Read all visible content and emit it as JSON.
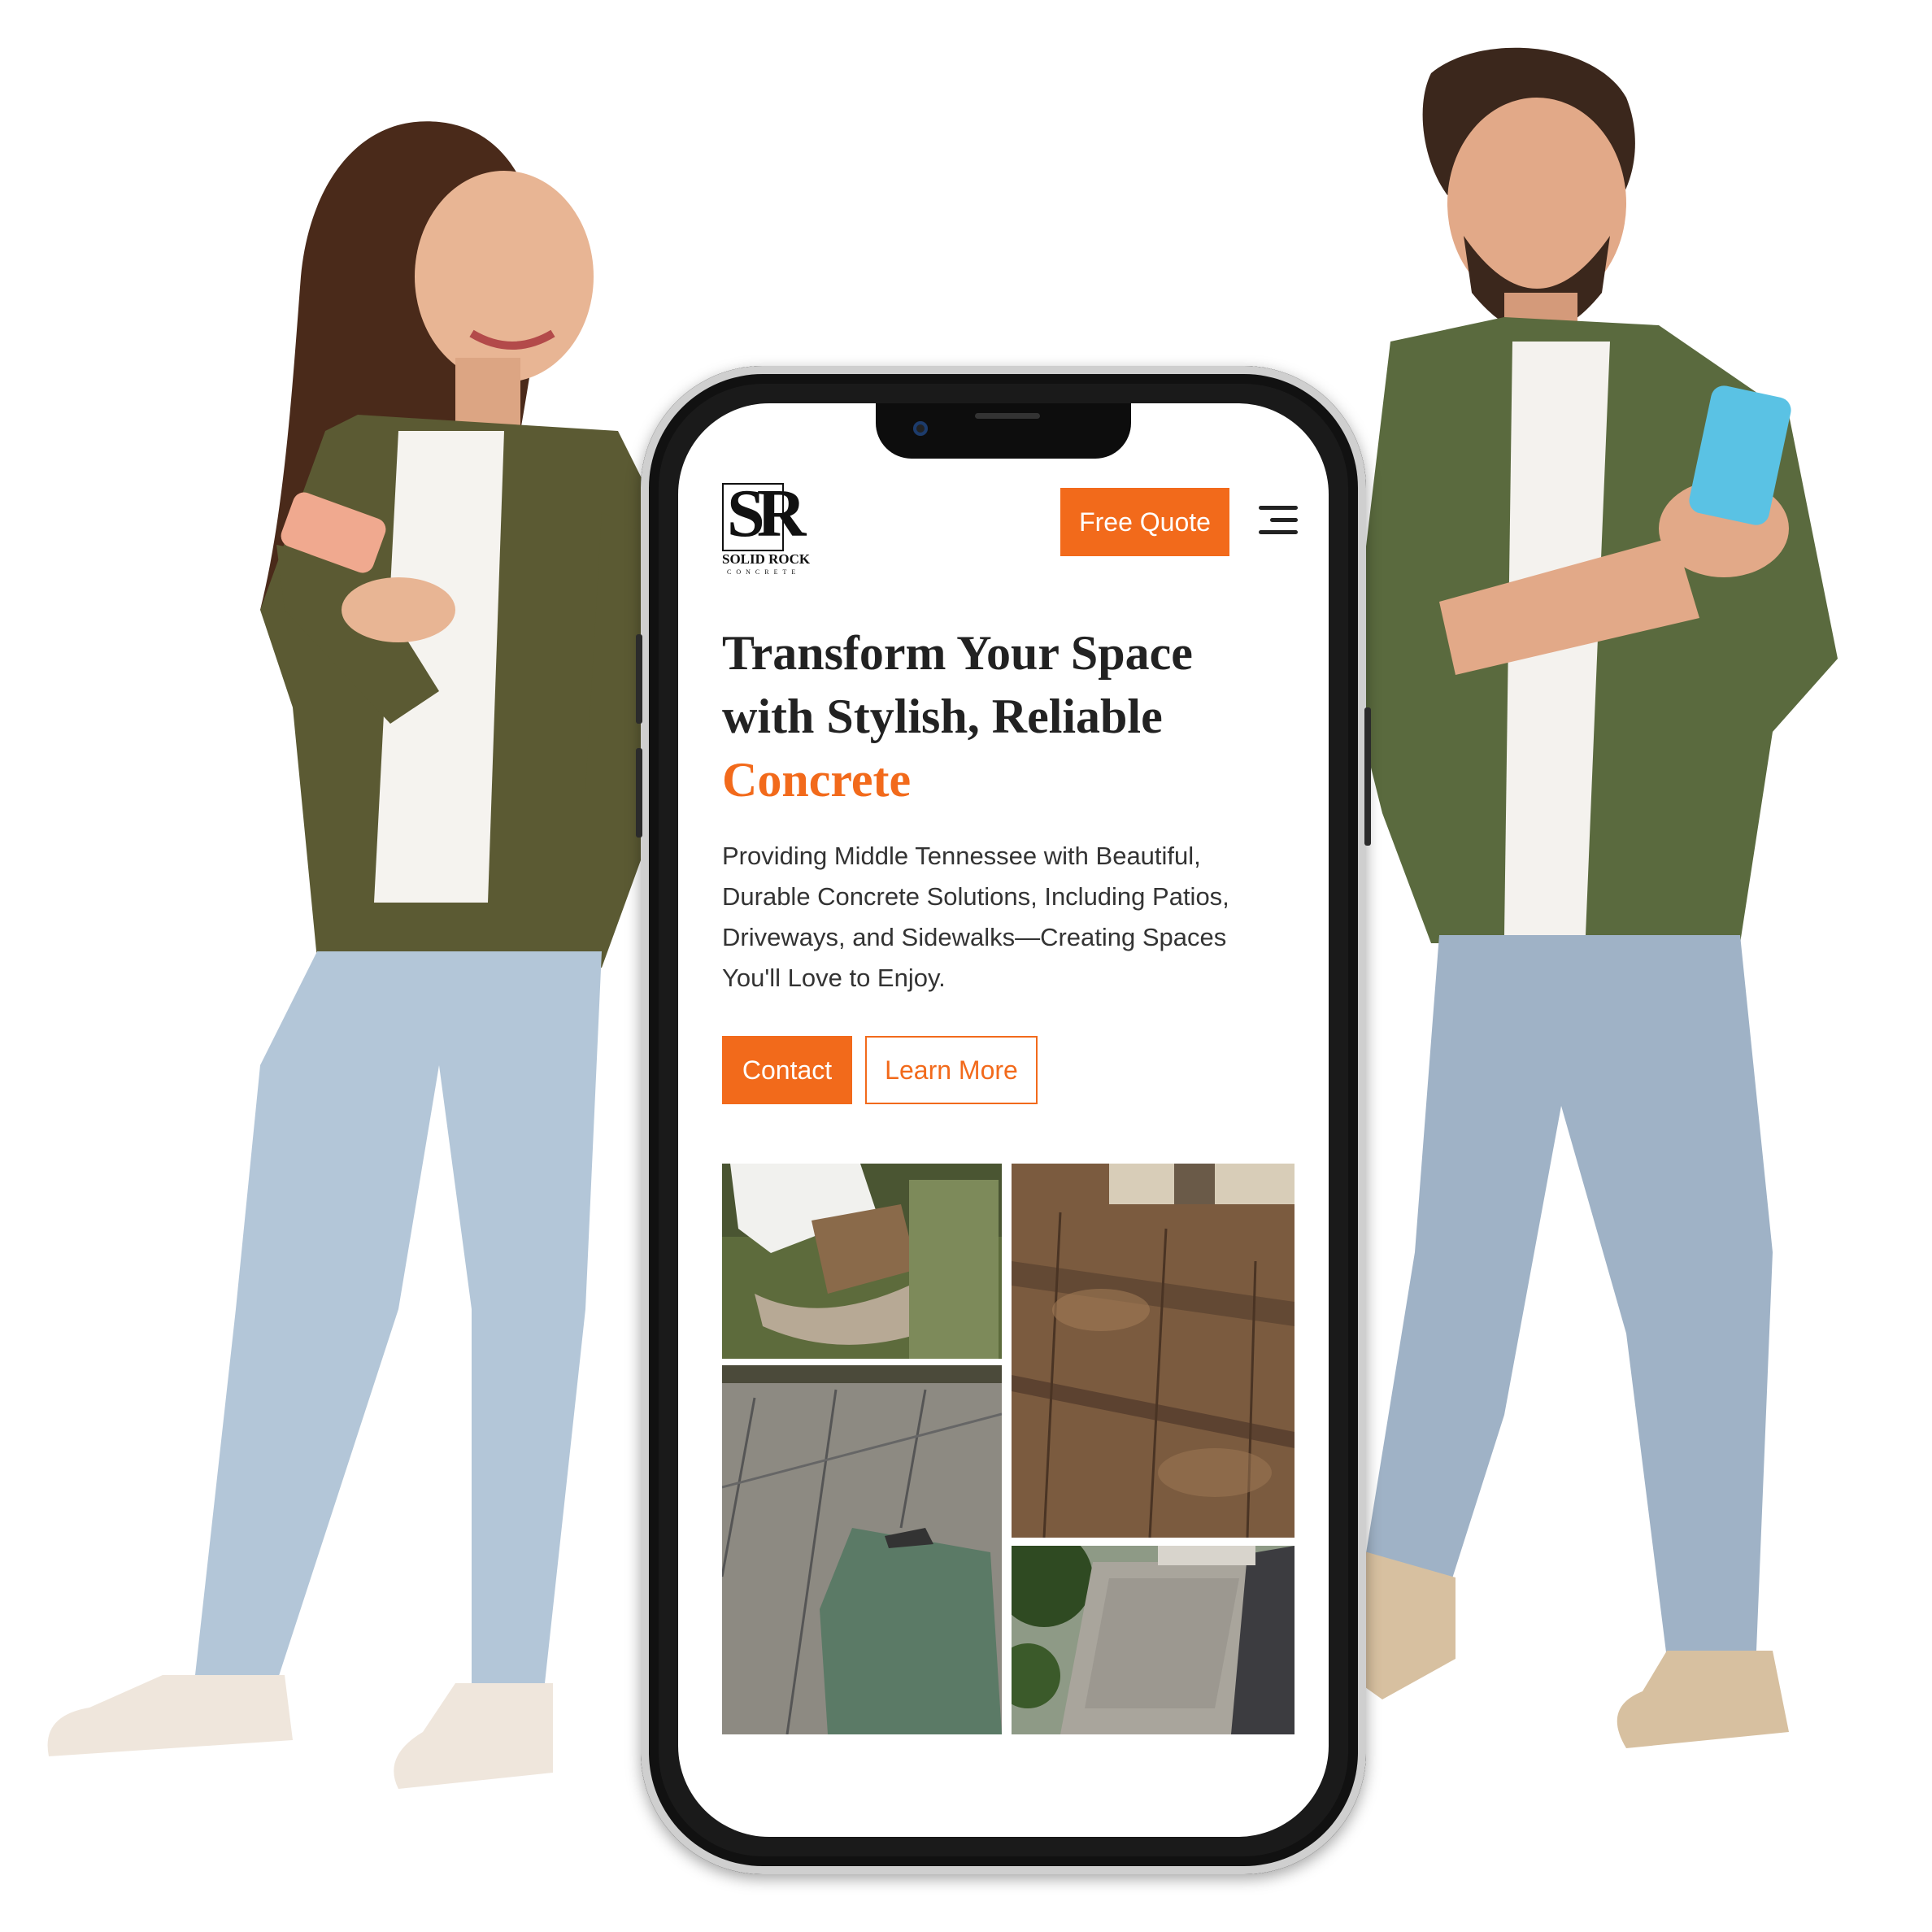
{
  "site": {
    "logo": {
      "letters": "SR",
      "name": "SOLID ROCK",
      "tagline": "CONCRETE"
    },
    "header": {
      "quote_button": "Free Quote",
      "menu_icon": "hamburger-icon"
    },
    "hero": {
      "title_line1": "Transform Your Space",
      "title_line2": "with Stylish, Reliable",
      "title_accent": "Concrete",
      "description": "Providing Middle Tennessee with Beautiful, Durable Concrete Solutions, Including Patios, Driveways, and Sidewalks—Creating Spaces You'll Love to Enjoy.",
      "contact_button": "Contact",
      "learn_button": "Learn More"
    },
    "gallery": [
      {
        "name": "patio-aerial-photo"
      },
      {
        "name": "stamped-wood-concrete-photo"
      },
      {
        "name": "stamped-concrete-mat-photo"
      },
      {
        "name": "driveway-aerial-photo"
      }
    ]
  },
  "colors": {
    "accent": "#f26a1b",
    "text": "#222222",
    "background": "#ffffff"
  }
}
